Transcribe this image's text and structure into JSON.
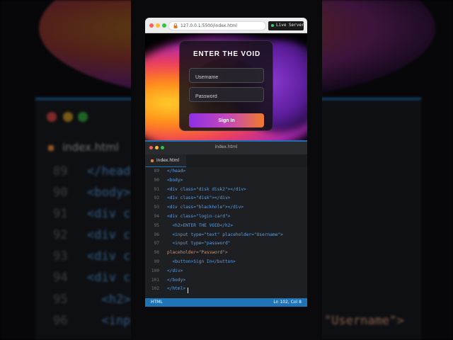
{
  "background": {
    "tab_label": "index.html",
    "lines": [
      {
        "num": "89",
        "code": "</head"
      },
      {
        "num": "90",
        "code": "<body>"
      },
      {
        "num": "91",
        "code": "<div c"
      },
      {
        "num": "92",
        "code": "<div c"
      },
      {
        "num": "93",
        "code": "<div c"
      },
      {
        "num": "94",
        "code": "<div c"
      },
      {
        "num": "95",
        "code": "  <h2>"
      },
      {
        "num": "96",
        "code": "  <inp"
      }
    ],
    "right_snippet": "\"Username\">"
  },
  "browser": {
    "url": "127.0.0.1:5500/index.html",
    "live_server_label": "Live Server",
    "colors": {
      "close": "#ff5f57",
      "minimize": "#febc2e",
      "zoom": "#28c840"
    }
  },
  "login": {
    "title": "ENTER THE VOID",
    "username_placeholder": "Username",
    "password_placeholder": "Password",
    "button_label": "Sign In",
    "button_gradient": [
      "#8e2fe6",
      "#c84ab4",
      "#f07a2a"
    ]
  },
  "editor": {
    "window_title": "index.html",
    "tab_label": "index.html",
    "status_language": "HTML",
    "status_position": "Ln 102, Col 8",
    "accent": "#1f73b7"
  },
  "code_lines": [
    {
      "num": "89",
      "text": "</head>"
    },
    {
      "num": "90",
      "text": "<body>"
    },
    {
      "num": "91",
      "text": "<div class=\"disk disk2\"></div>"
    },
    {
      "num": "92",
      "text": "<div class=\"disk\"></div>"
    },
    {
      "num": "93",
      "text": "<div class=\"blackhole\"></div>"
    },
    {
      "num": "94",
      "text": "<div class=\"login-card\">"
    },
    {
      "num": "95",
      "text": "  <h2>ENTER THE VOID</h2>"
    },
    {
      "num": "96",
      "text": "  <input type=\"text\" placeholder=\"Username\">"
    },
    {
      "num": "97",
      "text": "  <input type=\"password\""
    },
    {
      "num": "98",
      "text": "placeholder=\"Password\">"
    },
    {
      "num": "99",
      "text": "  <button>Sign In</button>"
    },
    {
      "num": "100",
      "text": "</div>"
    },
    {
      "num": "101",
      "text": "</body>"
    },
    {
      "num": "102",
      "text": "</html>"
    }
  ]
}
